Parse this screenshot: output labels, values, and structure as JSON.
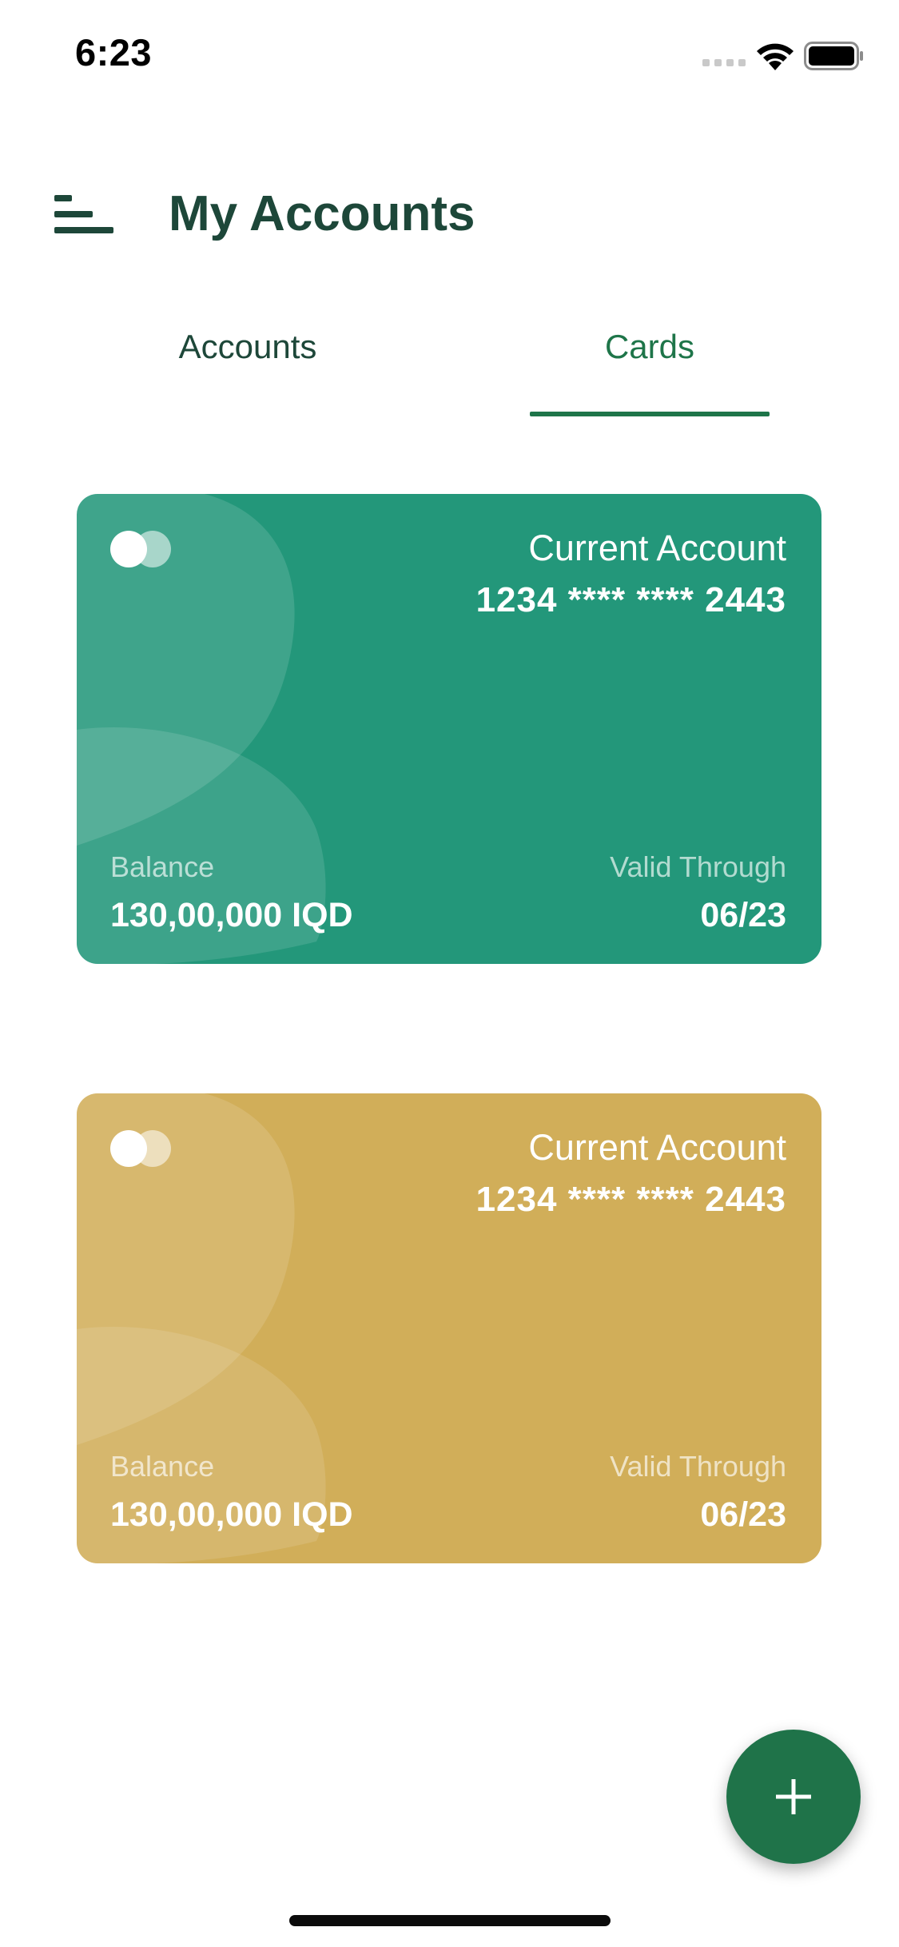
{
  "status_bar": {
    "time": "6:23",
    "icons": [
      "signal-icon",
      "wifi-icon",
      "battery-icon"
    ]
  },
  "header": {
    "title": "My Accounts",
    "menu_icon": "menu-icon"
  },
  "tabs": [
    {
      "label": "Accounts",
      "selected": false
    },
    {
      "label": "Cards",
      "selected": true
    }
  ],
  "cards": [
    {
      "color": "#23977a",
      "type": "Current Account",
      "number": "1234 **** **** 2443",
      "balance_label": "Balance",
      "balance": "130,00,000 IQD",
      "valid_label": "Valid Through",
      "valid": "06/23"
    },
    {
      "color": "#d1ae59",
      "type": "Current Account",
      "number": "1234 **** **** 2443",
      "balance_label": "Balance",
      "balance": "130,00,000 IQD",
      "valid_label": "Valid Through",
      "valid": "06/23"
    }
  ],
  "fab": {
    "icon": "plus-icon",
    "color": "#1f7349"
  },
  "colors": {
    "primary_dark": "#1d4739",
    "accent": "#1e7549"
  }
}
